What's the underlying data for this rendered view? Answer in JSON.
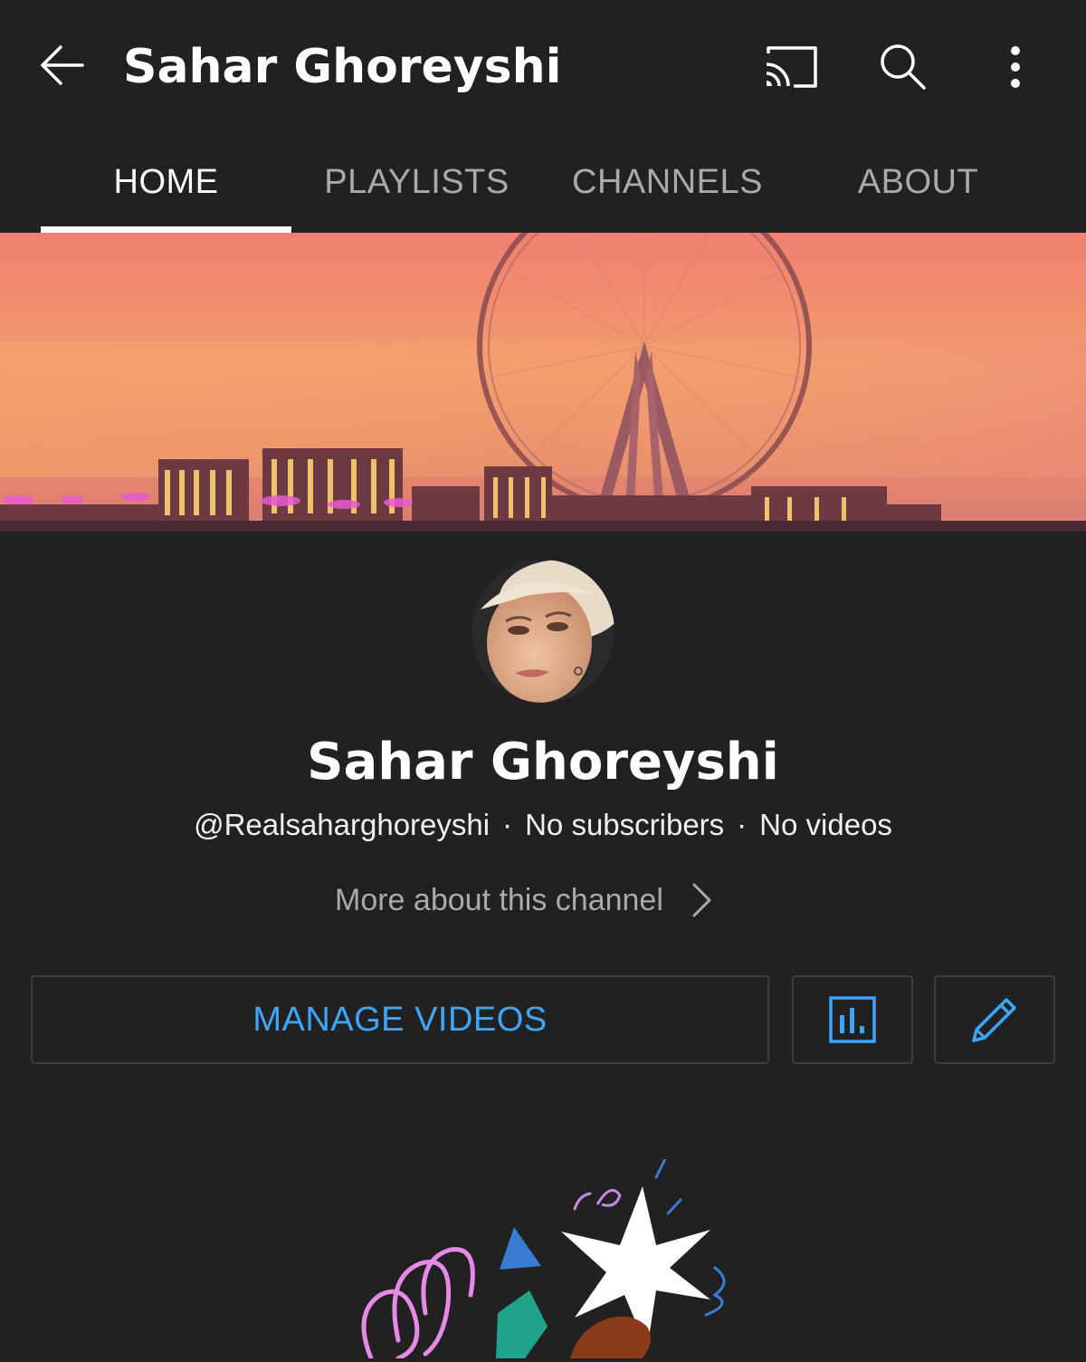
{
  "app_bar": {
    "title": "Sahar Ghoreyshi",
    "icons": [
      "back-arrow-icon",
      "cast-icon",
      "search-icon",
      "more-vert-icon"
    ]
  },
  "tabs": [
    {
      "label": "HOME",
      "active": true
    },
    {
      "label": "PLAYLISTS",
      "active": false
    },
    {
      "label": "CHANNELS",
      "active": false
    },
    {
      "label": "ABOUT",
      "active": false
    }
  ],
  "channel": {
    "name": "Sahar Ghoreyshi",
    "handle": "@Realsaharghoreyshi",
    "subscribers": "No subscribers",
    "videos": "No videos",
    "separator": "·",
    "more_about": "More about this channel"
  },
  "actions": {
    "manage_videos": "MANAGE VIDEOS",
    "analytics_icon": "analytics-bar-chart-icon",
    "edit_icon": "pencil-edit-icon"
  },
  "colors": {
    "background": "#212121",
    "accent_blue": "#3ea6ff",
    "secondary_text": "#aaaaaa",
    "button_border": "#3d3d3d"
  }
}
